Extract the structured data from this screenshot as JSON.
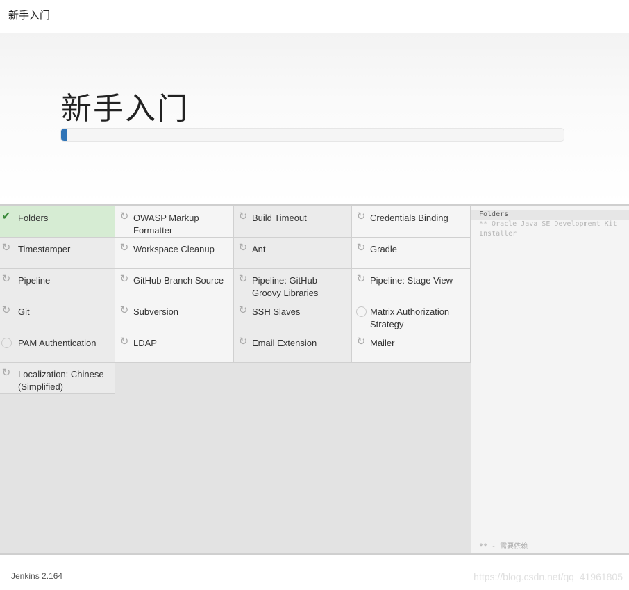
{
  "header": {
    "title": "新手入门"
  },
  "hero": {
    "title": "新手入门",
    "progress_percent": 1.2
  },
  "plugins": [
    {
      "name": "Folders",
      "state": "success",
      "icon": "check-icon"
    },
    {
      "name": "OWASP Markup Formatter",
      "state": "pending",
      "icon": "refresh-icon"
    },
    {
      "name": "Build Timeout",
      "state": "pending",
      "icon": "refresh-icon"
    },
    {
      "name": "Credentials Binding",
      "state": "pending",
      "icon": "refresh-icon"
    },
    {
      "name": "Timestamper",
      "state": "pending",
      "icon": "refresh-icon"
    },
    {
      "name": "Workspace Cleanup",
      "state": "pending",
      "icon": "refresh-icon"
    },
    {
      "name": "Ant",
      "state": "pending",
      "icon": "refresh-icon"
    },
    {
      "name": "Gradle",
      "state": "pending",
      "icon": "refresh-icon"
    },
    {
      "name": "Pipeline",
      "state": "pending",
      "icon": "refresh-icon"
    },
    {
      "name": "GitHub Branch Source",
      "state": "pending",
      "icon": "refresh-icon"
    },
    {
      "name": "Pipeline: GitHub Groovy Libraries",
      "state": "pending",
      "icon": "refresh-icon"
    },
    {
      "name": "Pipeline: Stage View",
      "state": "pending",
      "icon": "refresh-icon"
    },
    {
      "name": "Git",
      "state": "pending",
      "icon": "refresh-icon"
    },
    {
      "name": "Subversion",
      "state": "pending",
      "icon": "refresh-icon"
    },
    {
      "name": "SSH Slaves",
      "state": "pending",
      "icon": "refresh-icon"
    },
    {
      "name": "Matrix Authorization Strategy",
      "state": "not-selected",
      "icon": "empty-circle-icon"
    },
    {
      "name": "PAM Authentication",
      "state": "not-selected",
      "icon": "empty-circle-icon"
    },
    {
      "name": "LDAP",
      "state": "pending",
      "icon": "refresh-icon"
    },
    {
      "name": "Email Extension",
      "state": "pending",
      "icon": "refresh-icon"
    },
    {
      "name": "Mailer",
      "state": "pending",
      "icon": "refresh-icon"
    },
    {
      "name": "Localization: Chinese (Simplified)",
      "state": "pending",
      "icon": "refresh-icon"
    }
  ],
  "install_log": {
    "current": "Folders",
    "dependency": "** Oracle Java SE Development Kit Installer",
    "legend": "** - 需要依赖"
  },
  "footer": {
    "version": "Jenkins 2.164",
    "watermark": "https://blog.csdn.net/qq_41961805"
  },
  "colors": {
    "progress": "#2f74b7",
    "success_bg": "#d6ecd3",
    "check": "#3a8a3a"
  }
}
